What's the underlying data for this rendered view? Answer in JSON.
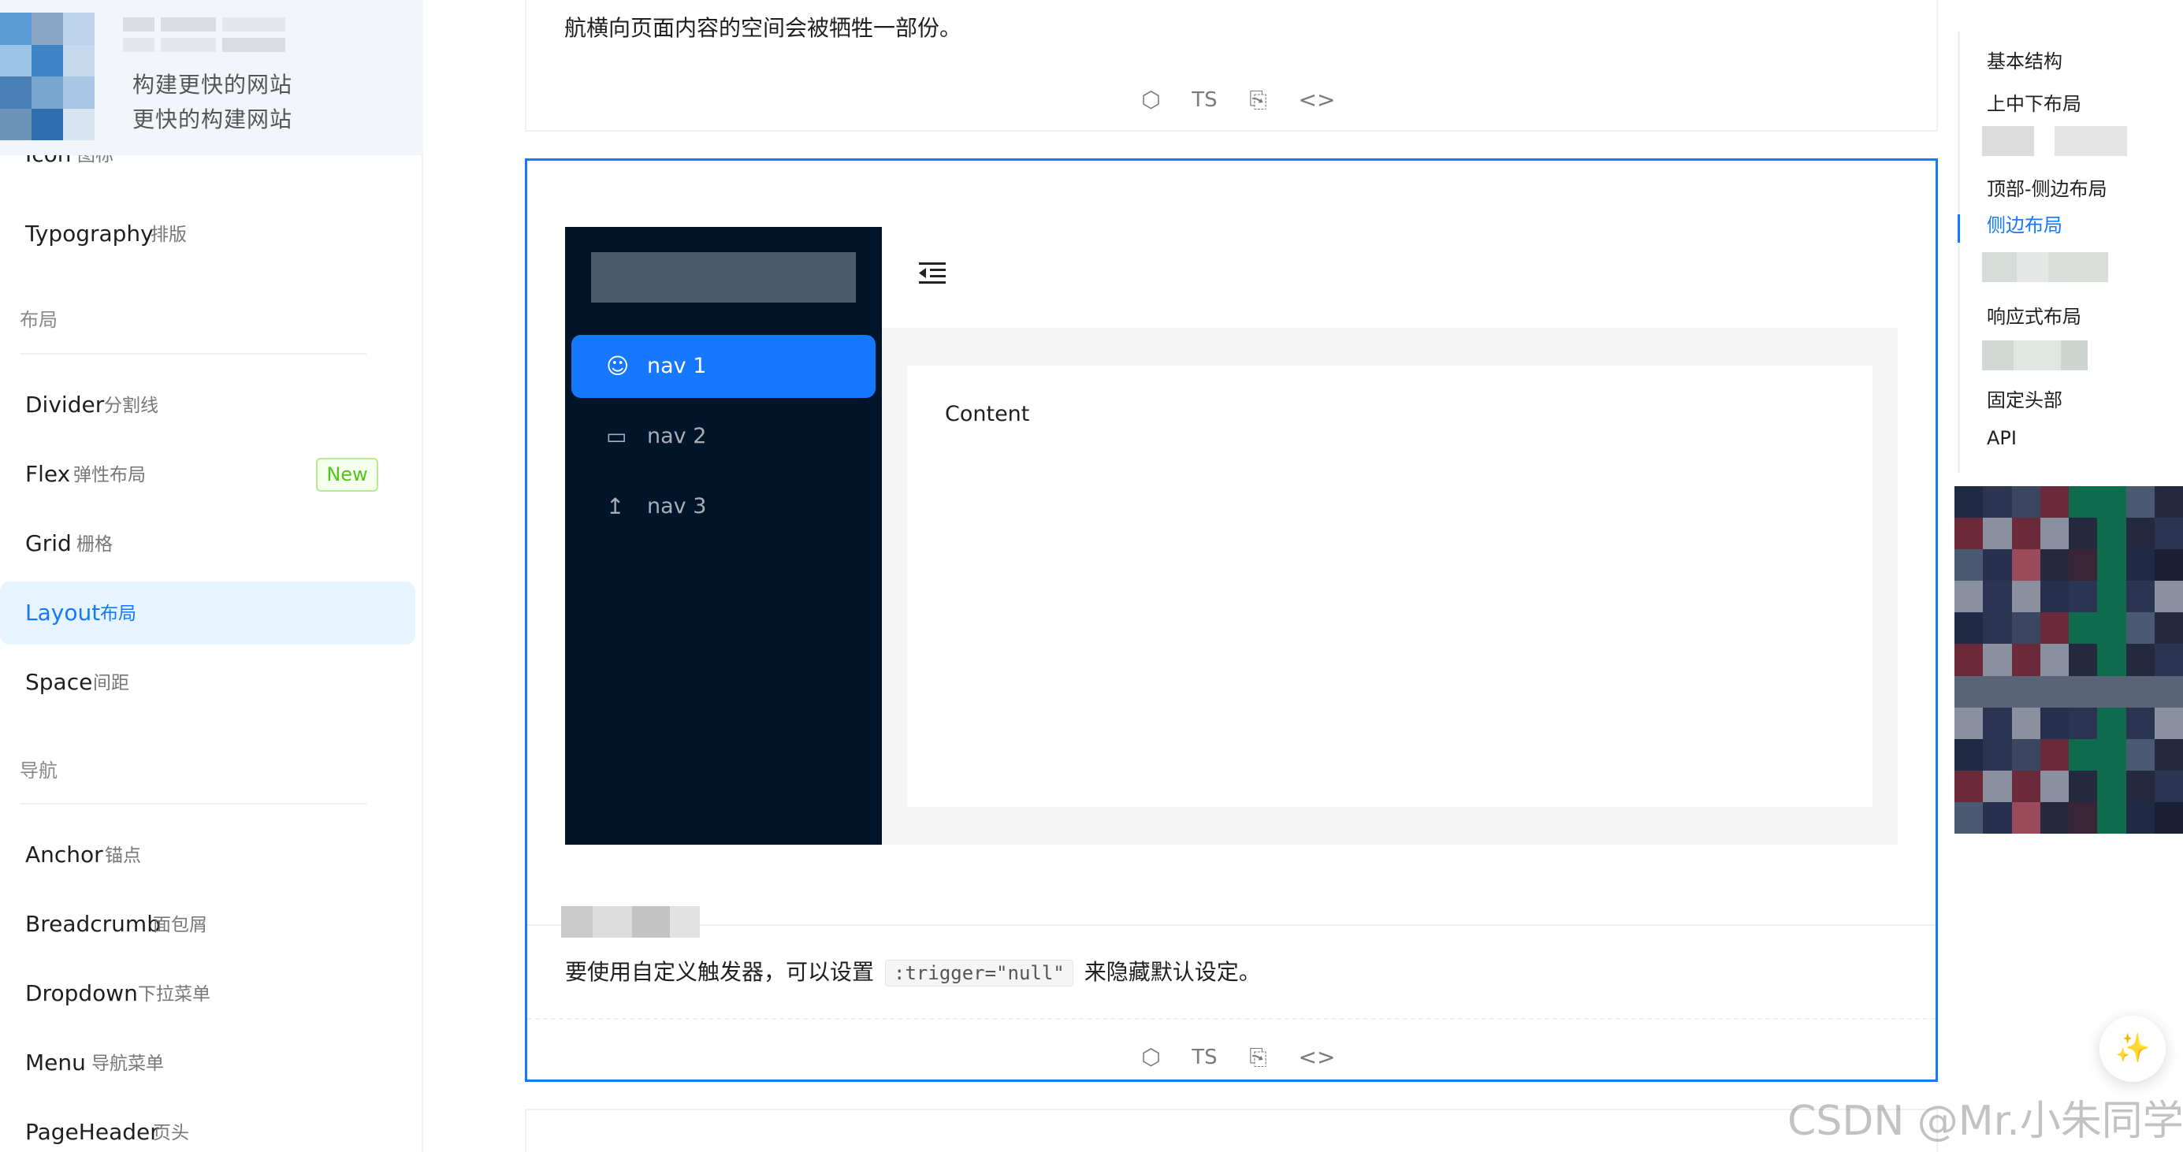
{
  "sidebar": {
    "slogan": [
      "构建更快的网站",
      "更快的构建网站"
    ],
    "items": [
      {
        "en": "Icon",
        "zh": "图标"
      },
      {
        "en": "Typography",
        "zh": "排版"
      },
      {
        "en": "Divider",
        "zh": "分割线"
      },
      {
        "en": "Flex",
        "zh": "弹性布局",
        "badge": "New"
      },
      {
        "en": "Grid",
        "zh": "栅格"
      },
      {
        "en": "Layout",
        "zh": "布局"
      },
      {
        "en": "Space",
        "zh": "间距"
      },
      {
        "en": "Anchor",
        "zh": "锚点"
      },
      {
        "en": "Breadcrumb",
        "zh": "面包屑"
      },
      {
        "en": "Dropdown",
        "zh": "下拉菜单"
      },
      {
        "en": "Menu",
        "zh": "导航菜单"
      },
      {
        "en": "PageHeader",
        "zh": "页头"
      }
    ],
    "groups": [
      "布局",
      "导航"
    ],
    "active": "Layout"
  },
  "top_card": {
    "text": "航横向页面内容的空间会被牺牲一部份。",
    "actions": {
      "sandbox": "codesandbox-icon",
      "ts": "TS",
      "copy": "copy-icon",
      "code": "code-expand-icon"
    }
  },
  "demo": {
    "nav": [
      {
        "label": "nav 1",
        "icon": "user-icon"
      },
      {
        "label": "nav 2",
        "icon": "video-camera-icon"
      },
      {
        "label": "nav 3",
        "icon": "upload-icon"
      }
    ],
    "content": "Content",
    "description_before": "要使用自定义触发器，可以设置",
    "description_code": ":trigger=\"null\"",
    "description_after": "来隐藏默认设定。",
    "actions": {
      "ts": "TS"
    }
  },
  "anchor": {
    "items": [
      "基本结构",
      "上中下布局",
      "顶部-侧边布局",
      "侧边布局",
      "响应式布局",
      "固定头部",
      "API"
    ],
    "active": "侧边布局"
  },
  "watermark": "CSDN @Mr.小朱同学",
  "colors": {
    "primary": "#1677ff",
    "sider": "#001529",
    "new_badge": "#52c41a"
  }
}
